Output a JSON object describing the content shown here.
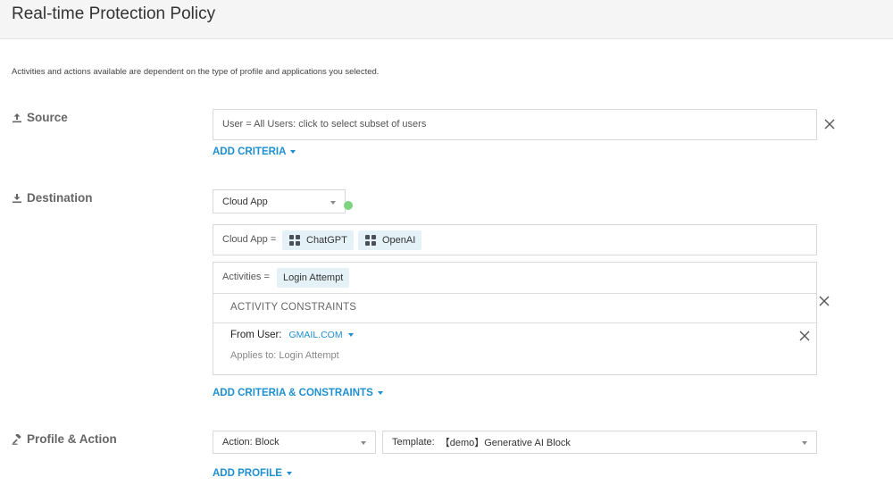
{
  "page": {
    "title": "Real-time Protection Policy",
    "info": "Activities and actions available are dependent on the type of profile and applications you selected."
  },
  "source": {
    "label": "Source",
    "user_field": "User = All Users: click to select subset of users",
    "add_criteria": "ADD CRITERIA"
  },
  "destination": {
    "label": "Destination",
    "type_select": "Cloud App",
    "cloud_app_prefix": "Cloud App =",
    "apps": [
      "ChatGPT",
      "OpenAI"
    ],
    "activities_prefix": "Activities =",
    "activity": "Login Attempt",
    "constraints_title": "ACTIVITY CONSTRAINTS",
    "from_user_label": "From User:",
    "from_user_value": "GMAIL.COM",
    "applies_to": "Applies to: Login Attempt",
    "add_criteria_constraints": "ADD CRITERIA & CONSTRAINTS"
  },
  "profile_action": {
    "label": "Profile & Action",
    "action_select": "Action: Block",
    "template_prefix": "Template:",
    "template_value": "【demo】Generative AI Block",
    "add_profile": "ADD PROFILE"
  },
  "colors": {
    "link": "#1e8fd0",
    "chip_bg": "#e4f2f8",
    "status_dot": "#7ed37f",
    "header_bg": "#f5f5f5"
  }
}
